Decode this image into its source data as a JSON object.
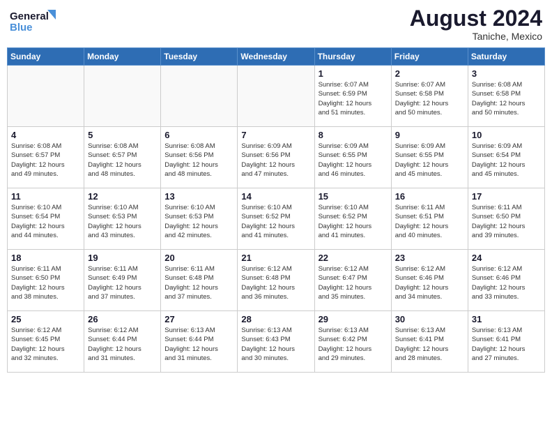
{
  "header": {
    "logo_line1": "General",
    "logo_line2": "Blue",
    "month_year": "August 2024",
    "location": "Taniche, Mexico"
  },
  "days_of_week": [
    "Sunday",
    "Monday",
    "Tuesday",
    "Wednesday",
    "Thursday",
    "Friday",
    "Saturday"
  ],
  "weeks": [
    [
      {
        "day": "",
        "info": ""
      },
      {
        "day": "",
        "info": ""
      },
      {
        "day": "",
        "info": ""
      },
      {
        "day": "",
        "info": ""
      },
      {
        "day": "1",
        "info": "Sunrise: 6:07 AM\nSunset: 6:59 PM\nDaylight: 12 hours\nand 51 minutes."
      },
      {
        "day": "2",
        "info": "Sunrise: 6:07 AM\nSunset: 6:58 PM\nDaylight: 12 hours\nand 50 minutes."
      },
      {
        "day": "3",
        "info": "Sunrise: 6:08 AM\nSunset: 6:58 PM\nDaylight: 12 hours\nand 50 minutes."
      }
    ],
    [
      {
        "day": "4",
        "info": "Sunrise: 6:08 AM\nSunset: 6:57 PM\nDaylight: 12 hours\nand 49 minutes."
      },
      {
        "day": "5",
        "info": "Sunrise: 6:08 AM\nSunset: 6:57 PM\nDaylight: 12 hours\nand 48 minutes."
      },
      {
        "day": "6",
        "info": "Sunrise: 6:08 AM\nSunset: 6:56 PM\nDaylight: 12 hours\nand 48 minutes."
      },
      {
        "day": "7",
        "info": "Sunrise: 6:09 AM\nSunset: 6:56 PM\nDaylight: 12 hours\nand 47 minutes."
      },
      {
        "day": "8",
        "info": "Sunrise: 6:09 AM\nSunset: 6:55 PM\nDaylight: 12 hours\nand 46 minutes."
      },
      {
        "day": "9",
        "info": "Sunrise: 6:09 AM\nSunset: 6:55 PM\nDaylight: 12 hours\nand 45 minutes."
      },
      {
        "day": "10",
        "info": "Sunrise: 6:09 AM\nSunset: 6:54 PM\nDaylight: 12 hours\nand 45 minutes."
      }
    ],
    [
      {
        "day": "11",
        "info": "Sunrise: 6:10 AM\nSunset: 6:54 PM\nDaylight: 12 hours\nand 44 minutes."
      },
      {
        "day": "12",
        "info": "Sunrise: 6:10 AM\nSunset: 6:53 PM\nDaylight: 12 hours\nand 43 minutes."
      },
      {
        "day": "13",
        "info": "Sunrise: 6:10 AM\nSunset: 6:53 PM\nDaylight: 12 hours\nand 42 minutes."
      },
      {
        "day": "14",
        "info": "Sunrise: 6:10 AM\nSunset: 6:52 PM\nDaylight: 12 hours\nand 41 minutes."
      },
      {
        "day": "15",
        "info": "Sunrise: 6:10 AM\nSunset: 6:52 PM\nDaylight: 12 hours\nand 41 minutes."
      },
      {
        "day": "16",
        "info": "Sunrise: 6:11 AM\nSunset: 6:51 PM\nDaylight: 12 hours\nand 40 minutes."
      },
      {
        "day": "17",
        "info": "Sunrise: 6:11 AM\nSunset: 6:50 PM\nDaylight: 12 hours\nand 39 minutes."
      }
    ],
    [
      {
        "day": "18",
        "info": "Sunrise: 6:11 AM\nSunset: 6:50 PM\nDaylight: 12 hours\nand 38 minutes."
      },
      {
        "day": "19",
        "info": "Sunrise: 6:11 AM\nSunset: 6:49 PM\nDaylight: 12 hours\nand 37 minutes."
      },
      {
        "day": "20",
        "info": "Sunrise: 6:11 AM\nSunset: 6:48 PM\nDaylight: 12 hours\nand 37 minutes."
      },
      {
        "day": "21",
        "info": "Sunrise: 6:12 AM\nSunset: 6:48 PM\nDaylight: 12 hours\nand 36 minutes."
      },
      {
        "day": "22",
        "info": "Sunrise: 6:12 AM\nSunset: 6:47 PM\nDaylight: 12 hours\nand 35 minutes."
      },
      {
        "day": "23",
        "info": "Sunrise: 6:12 AM\nSunset: 6:46 PM\nDaylight: 12 hours\nand 34 minutes."
      },
      {
        "day": "24",
        "info": "Sunrise: 6:12 AM\nSunset: 6:46 PM\nDaylight: 12 hours\nand 33 minutes."
      }
    ],
    [
      {
        "day": "25",
        "info": "Sunrise: 6:12 AM\nSunset: 6:45 PM\nDaylight: 12 hours\nand 32 minutes."
      },
      {
        "day": "26",
        "info": "Sunrise: 6:12 AM\nSunset: 6:44 PM\nDaylight: 12 hours\nand 31 minutes."
      },
      {
        "day": "27",
        "info": "Sunrise: 6:13 AM\nSunset: 6:44 PM\nDaylight: 12 hours\nand 31 minutes."
      },
      {
        "day": "28",
        "info": "Sunrise: 6:13 AM\nSunset: 6:43 PM\nDaylight: 12 hours\nand 30 minutes."
      },
      {
        "day": "29",
        "info": "Sunrise: 6:13 AM\nSunset: 6:42 PM\nDaylight: 12 hours\nand 29 minutes."
      },
      {
        "day": "30",
        "info": "Sunrise: 6:13 AM\nSunset: 6:41 PM\nDaylight: 12 hours\nand 28 minutes."
      },
      {
        "day": "31",
        "info": "Sunrise: 6:13 AM\nSunset: 6:41 PM\nDaylight: 12 hours\nand 27 minutes."
      }
    ]
  ]
}
